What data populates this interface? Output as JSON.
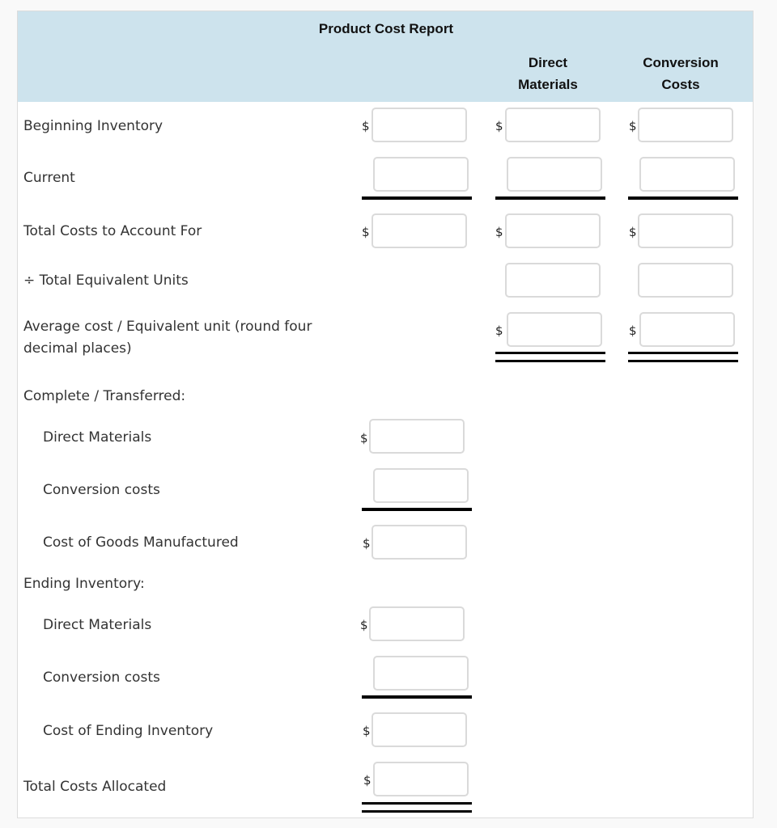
{
  "report": {
    "title": "Product Cost Report",
    "columns": {
      "direct_materials_line1": "Direct",
      "direct_materials_line2": "Materials",
      "conversion_costs_line1": "Conversion",
      "conversion_costs_line2": "Costs"
    },
    "currency_symbol": "$",
    "rows": {
      "beginning_inventory": "Beginning Inventory",
      "current": "Current",
      "total_costs_to_account_for": "Total Costs to Account For",
      "total_equivalent_units": "÷ Total Equivalent Units",
      "average_cost_line1": "Average cost / Equivalent unit (round four",
      "average_cost_line2": "decimal places)",
      "complete_transferred": "Complete / Transferred:",
      "ct_direct_materials": "Direct Materials",
      "ct_conversion_costs": "Conversion costs",
      "cost_of_goods_manufactured": "Cost of Goods Manufactured",
      "ending_inventory": "Ending Inventory:",
      "ei_direct_materials": "Direct Materials",
      "ei_conversion_costs": "Conversion costs",
      "cost_of_ending_inventory": "Cost of Ending Inventory",
      "total_costs_allocated": "Total Costs Allocated"
    },
    "inputs": {
      "value": ""
    }
  },
  "colors": {
    "header_bg": "#cde3ed",
    "input_border": "#dadada"
  }
}
